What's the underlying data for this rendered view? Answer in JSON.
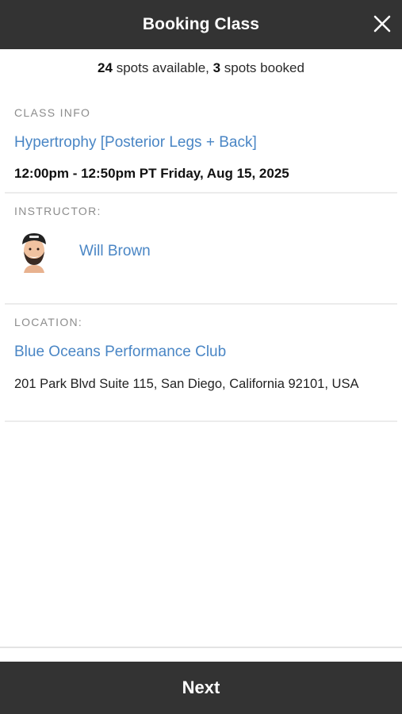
{
  "header": {
    "title": "Booking Class",
    "close_icon": "close-icon"
  },
  "availability": {
    "spots_available": "24",
    "available_text": " spots available, ",
    "spots_booked": "3",
    "booked_text": " spots booked"
  },
  "class_info": {
    "label": "CLASS INFO",
    "name": "Hypertrophy [Posterior Legs + Back]",
    "time": "12:00pm - 12:50pm PT Friday, Aug 15, 2025"
  },
  "instructor": {
    "label": "INSTRUCTOR:",
    "name": "Will Brown",
    "avatar_icon": "instructor-avatar"
  },
  "location": {
    "label": "LOCATION:",
    "name": "Blue Oceans Performance Club",
    "address": "201 Park Blvd Suite 115, San Diego, California 92101, USA"
  },
  "footer": {
    "next_label": "Next"
  },
  "colors": {
    "header_bg": "#333333",
    "link": "#4a86c5",
    "label": "#8c8c8c",
    "button_bg": "#333333"
  }
}
